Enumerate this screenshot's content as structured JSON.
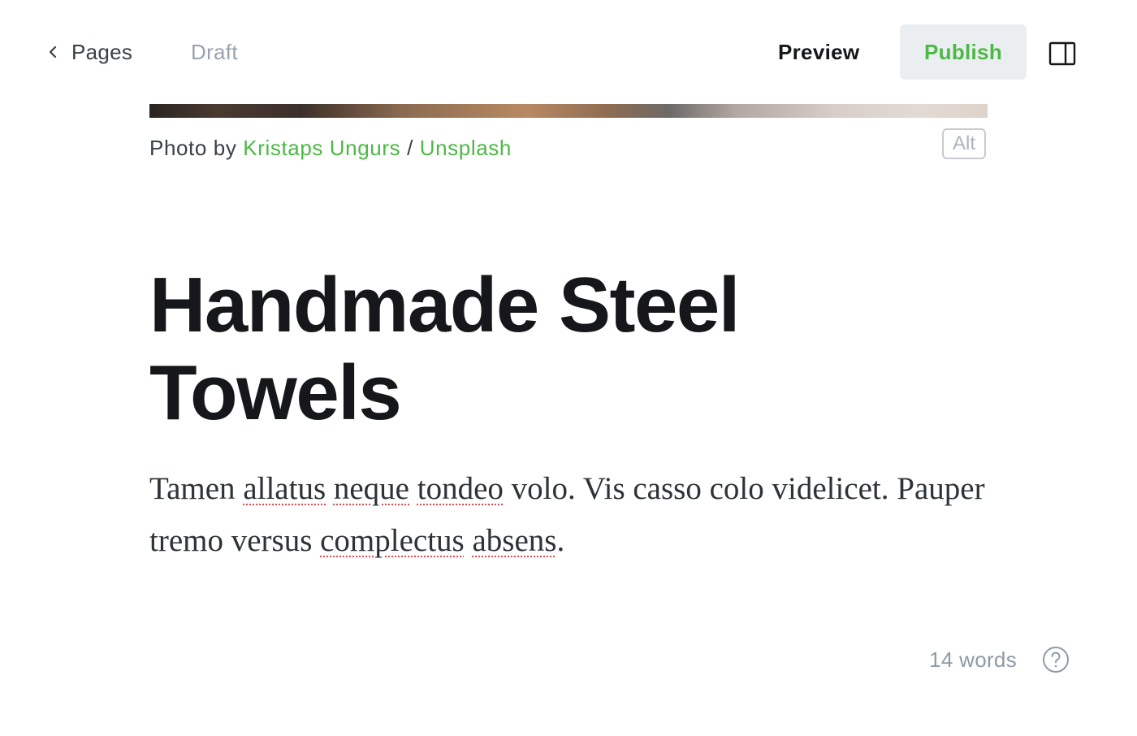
{
  "header": {
    "back_label": "Pages",
    "status": "Draft",
    "preview_label": "Preview",
    "publish_label": "Publish"
  },
  "feature_image": {
    "caption_prefix": "Photo by",
    "author": "Kristaps Ungurs",
    "separator": "/",
    "source": "Unsplash",
    "alt_label": "Alt"
  },
  "post": {
    "title": "Handmade Steel Towels",
    "body_segments": [
      {
        "text": "Tamen ",
        "misspelled": false
      },
      {
        "text": "allatus",
        "misspelled": true
      },
      {
        "text": " ",
        "misspelled": false
      },
      {
        "text": "neque",
        "misspelled": true
      },
      {
        "text": " ",
        "misspelled": false
      },
      {
        "text": "tondeo",
        "misspelled": true
      },
      {
        "text": " volo. Vis casso colo videlicet. Pauper tremo versus ",
        "misspelled": false
      },
      {
        "text": "complectus",
        "misspelled": true
      },
      {
        "text": " ",
        "misspelled": false
      },
      {
        "text": "absens",
        "misspelled": true
      },
      {
        "text": ".",
        "misspelled": false
      }
    ]
  },
  "footer": {
    "word_count": "14 words"
  },
  "icons": {
    "back": "chevron-left-icon",
    "sidebar": "sidebar-toggle-icon",
    "help": "help-circle-icon"
  },
  "colors": {
    "accent_green": "#4cb944",
    "publish_bg": "#ebeef0",
    "muted_text": "#99a3ad",
    "spellcheck_underline": "#e5484d"
  }
}
